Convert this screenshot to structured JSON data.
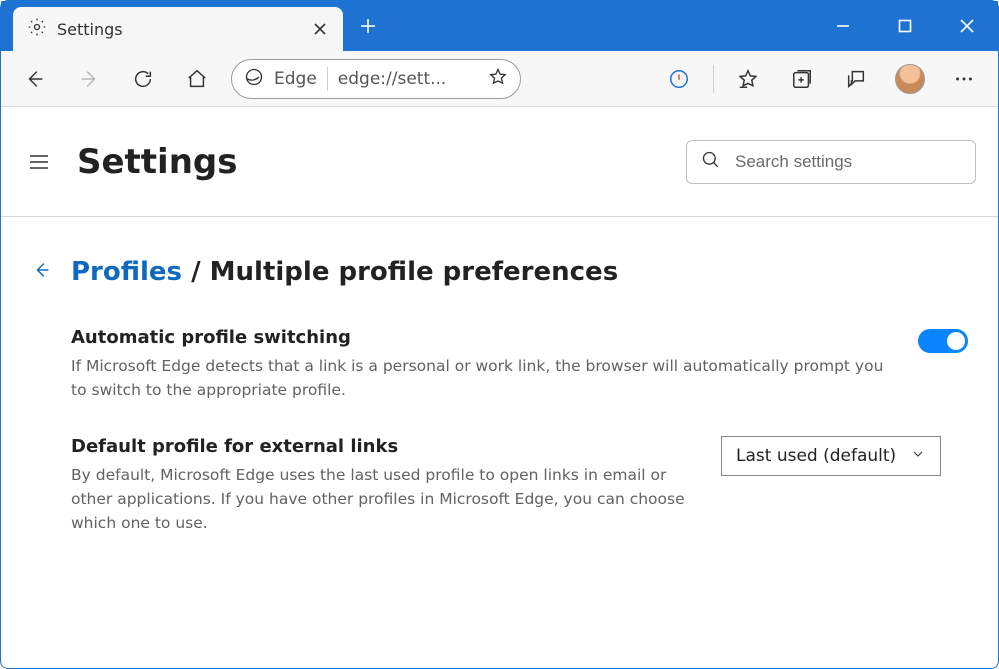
{
  "tab": {
    "title": "Settings"
  },
  "address": {
    "brand": "Edge",
    "url": "edge://sett..."
  },
  "header": {
    "title": "Settings"
  },
  "search": {
    "placeholder": "Search settings"
  },
  "breadcrumb": {
    "parent": "Profiles",
    "separator": " / ",
    "current": "Multiple profile preferences"
  },
  "settings": {
    "auto_switch": {
      "title": "Automatic profile switching",
      "desc": "If Microsoft Edge detects that a link is a personal or work link, the browser will automatically prompt you to switch to the appropriate profile.",
      "enabled": true
    },
    "default_profile": {
      "title": "Default profile for external links",
      "desc": "By default, Microsoft Edge uses the last used profile to open links in email or other applications. If you have other profiles in Microsoft Edge, you can choose which one to use.",
      "selected": "Last used (default)"
    }
  }
}
